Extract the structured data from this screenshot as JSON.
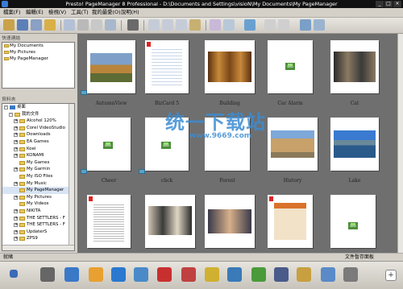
{
  "window": {
    "title": "Presto! PageManager 8 Professional - D:\\Documents and Settings\\visioN\\My Documents\\My PageManager"
  },
  "menu": [
    "檔案(F)",
    "編輯(E)",
    "檢視(V)",
    "工具(T)",
    "我的最愛(O)",
    "說明(H)"
  ],
  "favorites": {
    "header": "快速連結",
    "items": [
      "My Documents",
      "My Pictures",
      "My PageManager"
    ]
  },
  "folders": {
    "header": "資料夾",
    "items": [
      "桌面",
      "我的文件",
      "Alcohol 120%",
      "Corel VideoStudio",
      "Downloads",
      "EA Games",
      "Koei",
      "KONAMI",
      "My Games",
      "My Garmin",
      "My ISO Files",
      "My Music",
      "My PageManager",
      "My Pictures",
      "My Videos",
      "NIKITA",
      "THE SETTLERS - F",
      "THE SETTLERS - F",
      "UpdaterS",
      "ZPS9"
    ]
  },
  "thumbnails": [
    {
      "caption": "AutumnView"
    },
    {
      "caption": "BizCard 5"
    },
    {
      "caption": "Building"
    },
    {
      "caption": "Car Alarm"
    },
    {
      "caption": "Cat"
    },
    {
      "caption": "Cheer"
    },
    {
      "caption": "click"
    },
    {
      "caption": "Forest"
    },
    {
      "caption": "History"
    },
    {
      "caption": "Lake"
    },
    {
      "caption": ""
    },
    {
      "caption": ""
    },
    {
      "caption": ""
    },
    {
      "caption": ""
    },
    {
      "caption": ""
    }
  ],
  "labels": {
    "wav": "WAV"
  },
  "watermark": {
    "text": "统一下载站",
    "url": "www.9669.com"
  },
  "status": {
    "left": "就緒",
    "right": "文件暫存面板"
  }
}
